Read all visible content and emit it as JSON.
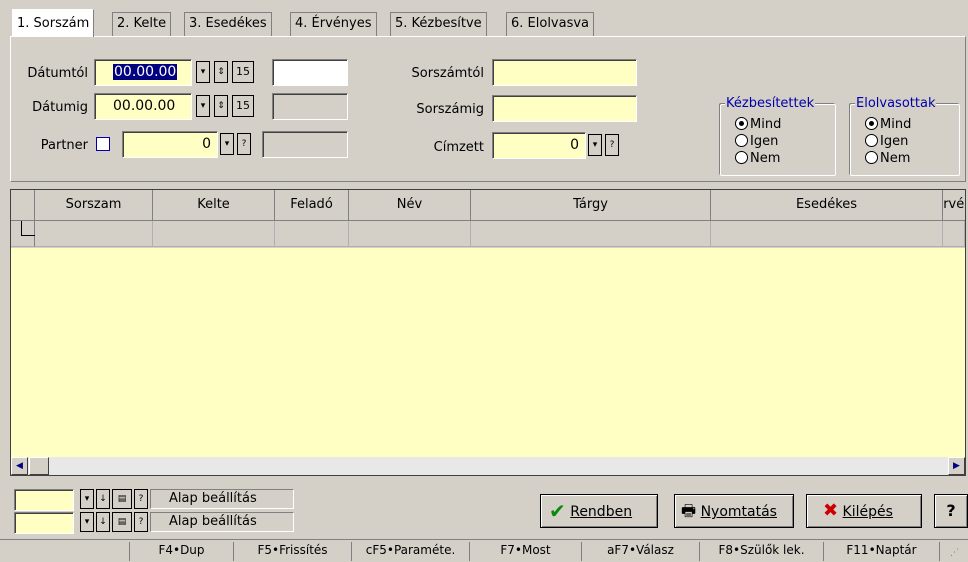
{
  "tabs": [
    {
      "label": "1. Sorszám"
    },
    {
      "label": "2. Kelte"
    },
    {
      "label": "3. Esedékes"
    },
    {
      "label": "4. Érvényes"
    },
    {
      "label": "5. Kézbesítve"
    },
    {
      "label": "6. Elolvasva"
    }
  ],
  "filters": {
    "datumtol": {
      "label": "Dátumtól",
      "value": "00.00.00"
    },
    "datumig": {
      "label": "Dátumig",
      "value": "00.00.00"
    },
    "partner": {
      "label": "Partner",
      "value": "0"
    },
    "sorszamtol": {
      "label": "Sorszámtól",
      "value": ""
    },
    "sorszamig": {
      "label": "Sorszámig",
      "value": ""
    },
    "cimzett": {
      "label": "Címzett",
      "value": "0"
    },
    "calendar_glyph": "15",
    "help_glyph": "?"
  },
  "kezbesitettek": {
    "title": "Kézbesítettek",
    "options": [
      "Mind",
      "Igen",
      "Nem"
    ],
    "selected": "Mind"
  },
  "elolvasottak": {
    "title": "Elolvasottak",
    "options": [
      "Mind",
      "Igen",
      "Nem"
    ],
    "selected": "Mind"
  },
  "table": {
    "columns": [
      "Sorszam",
      "Kelte",
      "Feladó",
      "Név",
      "Tárgy",
      "Esedékes",
      "Érvény"
    ]
  },
  "settings": {
    "row1_label": "Alap beállítás",
    "row2_label": "Alap beállítás",
    "help": "?"
  },
  "buttons": {
    "ok": "Rendben",
    "print": "Nyomtatás",
    "exit": "Kilépés",
    "help": "?"
  },
  "statusbar": [
    "F4•Dup",
    "F5•Frissítés",
    "cF5•Paraméte.",
    "F7•Most",
    "aF7•Válasz",
    "F8•Szülők lek.",
    "F11•Naptár"
  ]
}
